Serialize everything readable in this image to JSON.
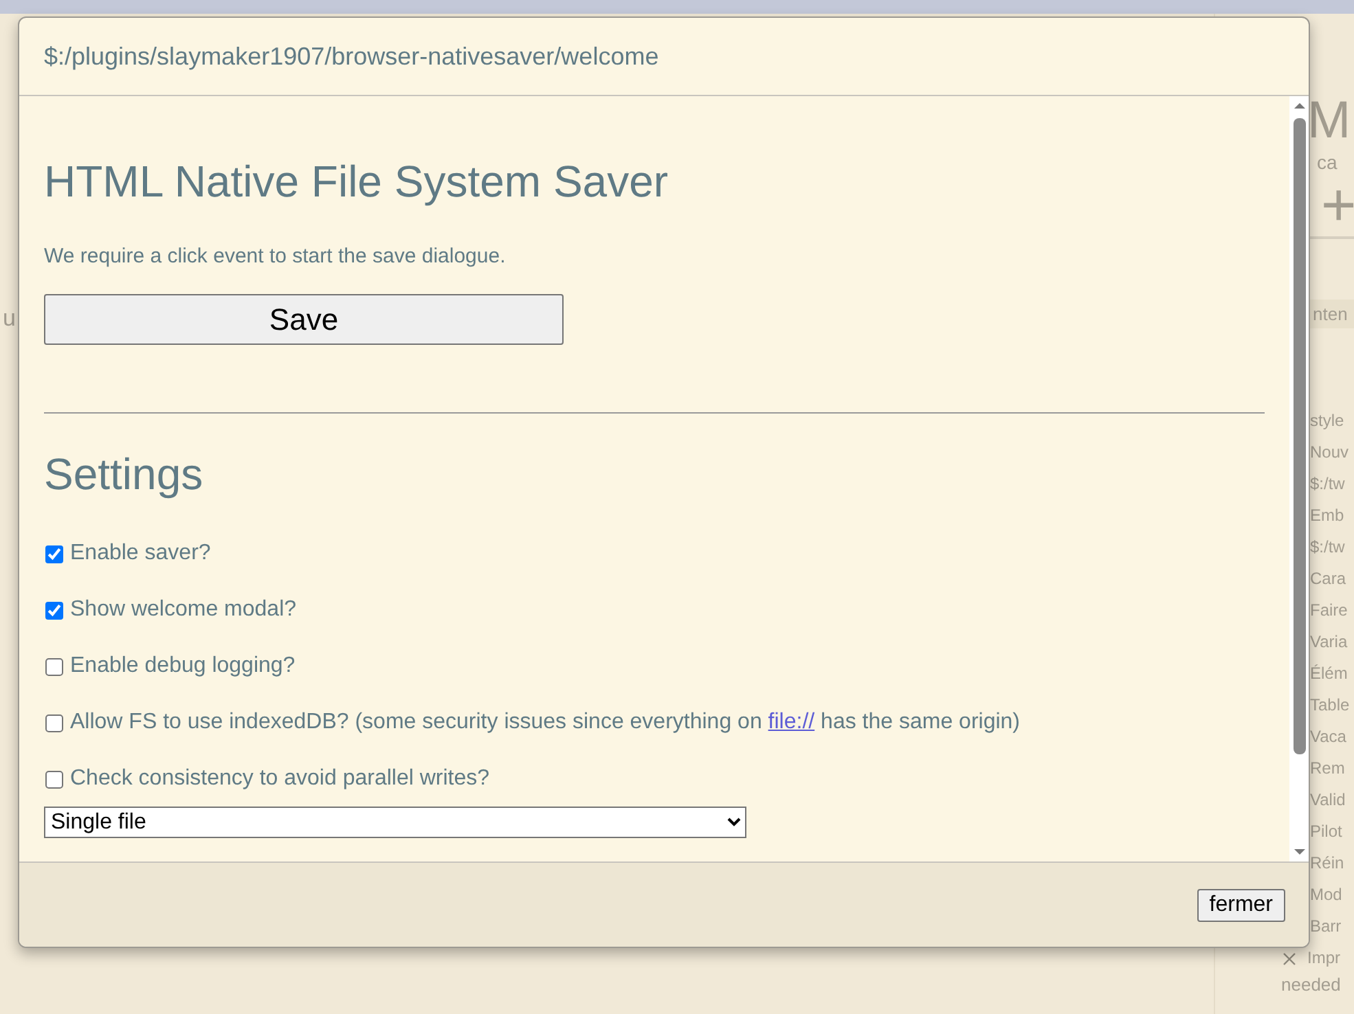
{
  "background": {
    "left_fragments": [
      "u"
    ],
    "right_title": "M",
    "right_subtitle": "ca",
    "right_buttons": [
      "+"
    ],
    "right_tab": "nten",
    "right_items": [
      {
        "label": "style",
        "removable": false
      },
      {
        "label": "Nouv",
        "removable": false
      },
      {
        "label": "$:/tw",
        "removable": false
      },
      {
        "label": "Emb",
        "removable": false
      },
      {
        "label": "$:/tw",
        "removable": false
      },
      {
        "label": "Cara",
        "removable": false
      },
      {
        "label": "Faire",
        "removable": false
      },
      {
        "label": "Varia",
        "removable": false
      },
      {
        "label": "Élém",
        "removable": false
      },
      {
        "label": "Table",
        "removable": false
      },
      {
        "label": "Vaca",
        "removable": false
      },
      {
        "label": "Rem",
        "removable": false
      },
      {
        "label": "Valid",
        "removable": false
      },
      {
        "label": "Pilot",
        "removable": false
      },
      {
        "label": "Réin",
        "removable": false
      },
      {
        "label": "Mod",
        "removable": false
      },
      {
        "label": "Barr",
        "removable": false
      },
      {
        "label": "Impr",
        "removable": true
      }
    ],
    "right_footer": "needed"
  },
  "modal": {
    "title": "$:/plugins/slaymaker1907/browser-nativesaver/welcome",
    "heading": "HTML Native File System Saver",
    "intro": "We require a click event to start the save dialogue.",
    "save_button": "Save",
    "settings_heading": "Settings",
    "options": [
      {
        "label": "Enable saver?",
        "checked": true
      },
      {
        "label": "Show welcome modal?",
        "checked": true
      },
      {
        "label": "Enable debug logging?",
        "checked": false
      },
      {
        "label": "Allow FS to use indexedDB? (some security issues since everything on ",
        "link": "file://",
        "after": " has the same origin)",
        "checked": false
      },
      {
        "label": "Check consistency to avoid parallel writes?",
        "checked": false
      }
    ],
    "select_value": "Single file",
    "close_button": "fermer"
  }
}
